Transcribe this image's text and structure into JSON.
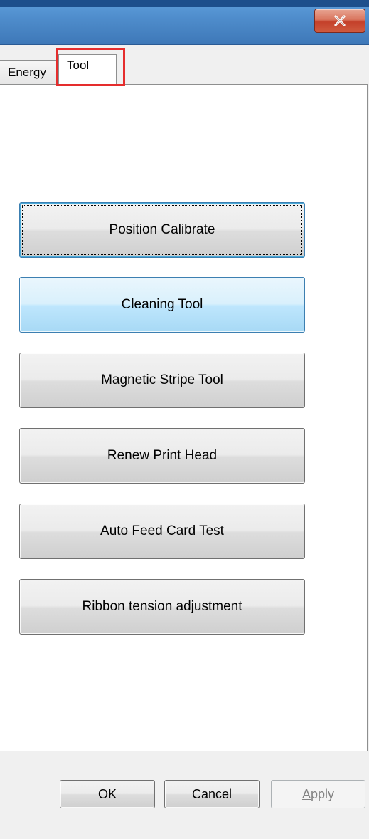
{
  "window": {
    "close_icon": "close-x-icon"
  },
  "tabs": [
    {
      "label": "Energy",
      "selected": false
    },
    {
      "label": "Tool",
      "selected": true
    }
  ],
  "tool_buttons": [
    {
      "label": "Position Calibrate",
      "state": "focused"
    },
    {
      "label": "Cleaning Tool",
      "state": "hover"
    },
    {
      "label": "Magnetic Stripe Tool",
      "state": "normal"
    },
    {
      "label": "Renew Print Head",
      "state": "normal"
    },
    {
      "label": "Auto Feed Card Test",
      "state": "normal"
    },
    {
      "label": "Ribbon tension adjustment",
      "state": "normal"
    }
  ],
  "dialog_buttons": {
    "ok": "OK",
    "cancel": "Cancel",
    "apply_prefix": "A",
    "apply_rest": "pply",
    "apply_enabled": false
  },
  "colors": {
    "highlight_box": "#e52d2d",
    "titlebar": "#4f8dcc",
    "close_button": "#c4402a"
  }
}
